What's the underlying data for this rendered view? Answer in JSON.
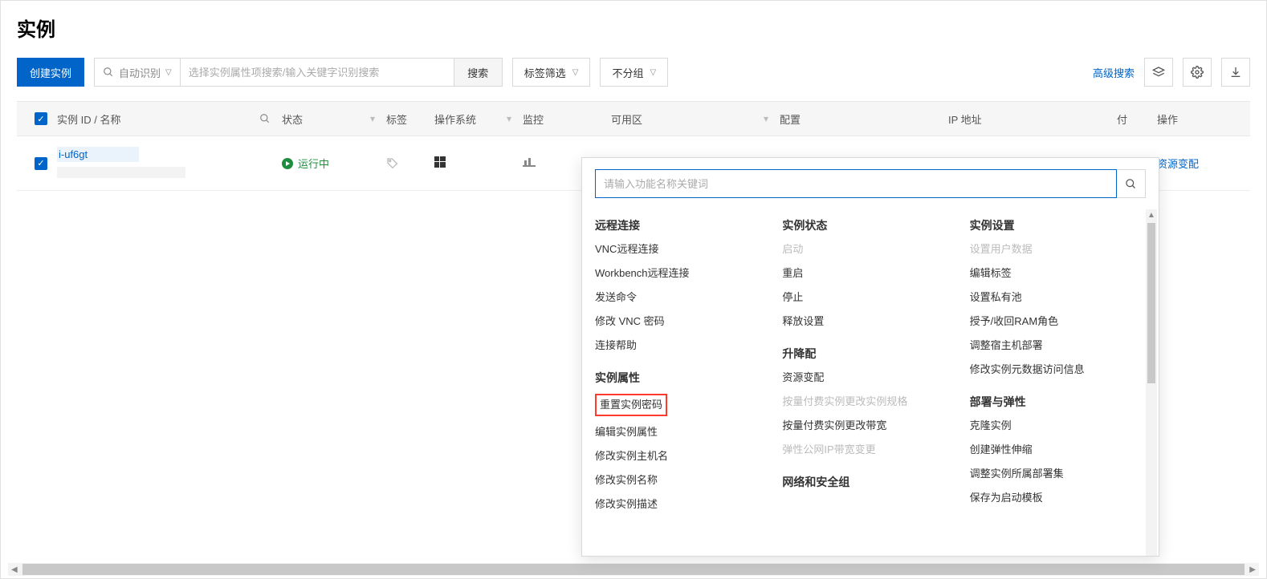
{
  "page_title": "实例",
  "toolbar": {
    "create": "创建实例",
    "auto_detect": "自动识别",
    "search_placeholder": "选择实例属性项搜索/输入关键字识别搜索",
    "search_btn": "搜索",
    "tag_filter": "标签筛选",
    "group": "不分组",
    "advanced": "高级搜索"
  },
  "columns": {
    "id": "实例 ID / 名称",
    "status": "状态",
    "tag": "标签",
    "os": "操作系统",
    "monitor": "监控",
    "zone": "可用区",
    "conf": "配置",
    "ip": "IP 地址",
    "pay": "付",
    "ops": "操作"
  },
  "row": {
    "id": "i-uf6gt",
    "status": "运行中",
    "action": "资源变配"
  },
  "popover": {
    "search_placeholder": "请输入功能名称关键词",
    "cols": [
      {
        "groups": [
          {
            "title": "远程连接",
            "items": [
              {
                "label": "VNC远程连接"
              },
              {
                "label": "Workbench远程连接"
              },
              {
                "label": "发送命令"
              },
              {
                "label": "修改 VNC 密码"
              },
              {
                "label": "连接帮助"
              }
            ]
          },
          {
            "title": "实例属性",
            "items": [
              {
                "label": "重置实例密码",
                "highlight": true
              },
              {
                "label": "编辑实例属性"
              },
              {
                "label": "修改实例主机名"
              },
              {
                "label": "修改实例名称"
              },
              {
                "label": "修改实例描述"
              }
            ]
          }
        ]
      },
      {
        "groups": [
          {
            "title": "实例状态",
            "items": [
              {
                "label": "启动",
                "disabled": true
              },
              {
                "label": "重启"
              },
              {
                "label": "停止"
              },
              {
                "label": "释放设置"
              }
            ]
          },
          {
            "title": "升降配",
            "items": [
              {
                "label": "资源变配"
              },
              {
                "label": "按量付费实例更改实例规格",
                "disabled": true
              },
              {
                "label": "按量付费实例更改带宽"
              },
              {
                "label": "弹性公网IP带宽变更",
                "disabled": true
              }
            ]
          },
          {
            "title": "网络和安全组",
            "items": []
          }
        ]
      },
      {
        "groups": [
          {
            "title": "实例设置",
            "items": [
              {
                "label": "设置用户数据",
                "disabled": true
              },
              {
                "label": "编辑标签"
              },
              {
                "label": "设置私有池"
              },
              {
                "label": "授予/收回RAM角色"
              },
              {
                "label": "调整宿主机部署"
              },
              {
                "label": "修改实例元数据访问信息"
              }
            ]
          },
          {
            "title": "部署与弹性",
            "items": [
              {
                "label": "克隆实例"
              },
              {
                "label": "创建弹性伸缩"
              },
              {
                "label": "调整实例所属部署集"
              },
              {
                "label": "保存为启动模板"
              }
            ]
          }
        ]
      }
    ]
  }
}
